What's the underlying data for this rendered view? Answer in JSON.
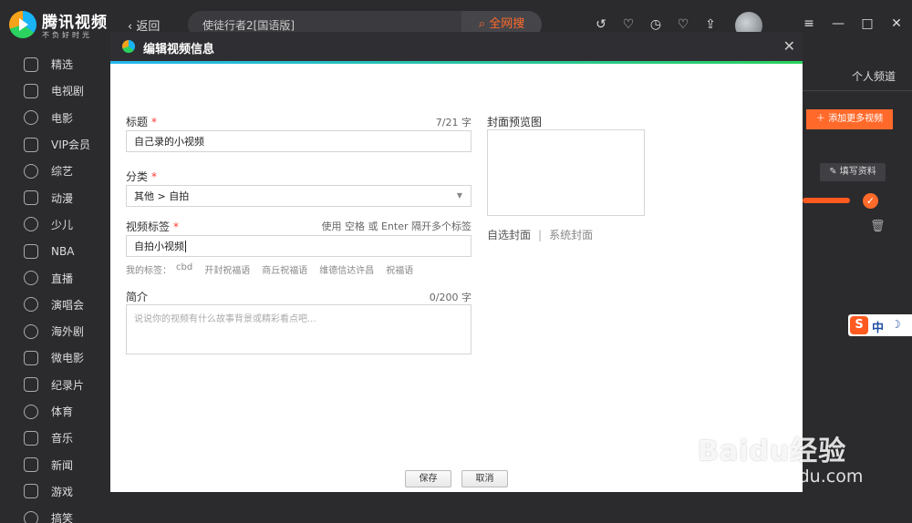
{
  "app": {
    "logo_title": "腾讯视频",
    "logo_sub": "不负好时光",
    "back_label": "返回",
    "search_value": "使徒行者2[国语版]",
    "search_button": "全网搜"
  },
  "sidebar": {
    "items": [
      {
        "label": "精选",
        "icon": "thumbs-up-icon"
      },
      {
        "label": "电视剧",
        "icon": "tv-icon"
      },
      {
        "label": "电影",
        "icon": "film-reel-icon"
      },
      {
        "label": "VIP会员",
        "icon": "vip-crown-icon"
      },
      {
        "label": "综艺",
        "icon": "variety-icon"
      },
      {
        "label": "动漫",
        "icon": "anime-icon"
      },
      {
        "label": "少儿",
        "icon": "kids-icon"
      },
      {
        "label": "NBA",
        "icon": "nba-icon"
      },
      {
        "label": "直播",
        "icon": "microphone-icon"
      },
      {
        "label": "演唱会",
        "icon": "concert-mic-icon"
      },
      {
        "label": "海外剧",
        "icon": "globe-icon"
      },
      {
        "label": "微电影",
        "icon": "clapper-icon"
      },
      {
        "label": "纪录片",
        "icon": "camera-icon"
      },
      {
        "label": "体育",
        "icon": "ball-icon"
      },
      {
        "label": "音乐",
        "icon": "music-note-icon"
      },
      {
        "label": "新闻",
        "icon": "news-icon"
      },
      {
        "label": "游戏",
        "icon": "gamepad-icon"
      },
      {
        "label": "搞笑",
        "icon": "smile-icon"
      }
    ]
  },
  "background": {
    "channel_label": "个人频道",
    "add_more_label": "添加更多视频",
    "fill_info_label": "填写资料"
  },
  "dialog": {
    "title": "编辑视频信息",
    "title_field": {
      "label": "标题",
      "required_mark": "*",
      "count": "7/21 字",
      "value": "自己录的小视频"
    },
    "category_field": {
      "label": "分类",
      "required_mark": "*",
      "value": "其他 > 自拍"
    },
    "tags_field": {
      "label": "视频标签",
      "required_mark": "*",
      "hint": "使用 空格 或 Enter 隔开多个标签",
      "value": "自拍小视频"
    },
    "my_tags": {
      "label": "我的标签：",
      "items": [
        "cbd",
        "开封祝福语",
        "商丘祝福语",
        "维德信达许昌",
        "祝福语"
      ]
    },
    "intro_field": {
      "label": "简介",
      "count": "0/200 字",
      "placeholder": "说说你的视频有什么故事背景或精彩看点吧..."
    },
    "cover": {
      "label": "封面预览图",
      "custom_label": "自选封面",
      "separator": "|",
      "system_label": "系统封面"
    },
    "save_label": "保存",
    "cancel_label": "取消"
  },
  "ime": {
    "logo": "S",
    "mode": "中",
    "moon": "☽"
  },
  "watermark": {
    "main": "Baidu经验",
    "sub": "jingyan.baidu.com"
  },
  "colors": {
    "accent_orange": "#ff6a2b",
    "bg_dark": "#2b2b2e",
    "required_red": "#ff3b30"
  }
}
